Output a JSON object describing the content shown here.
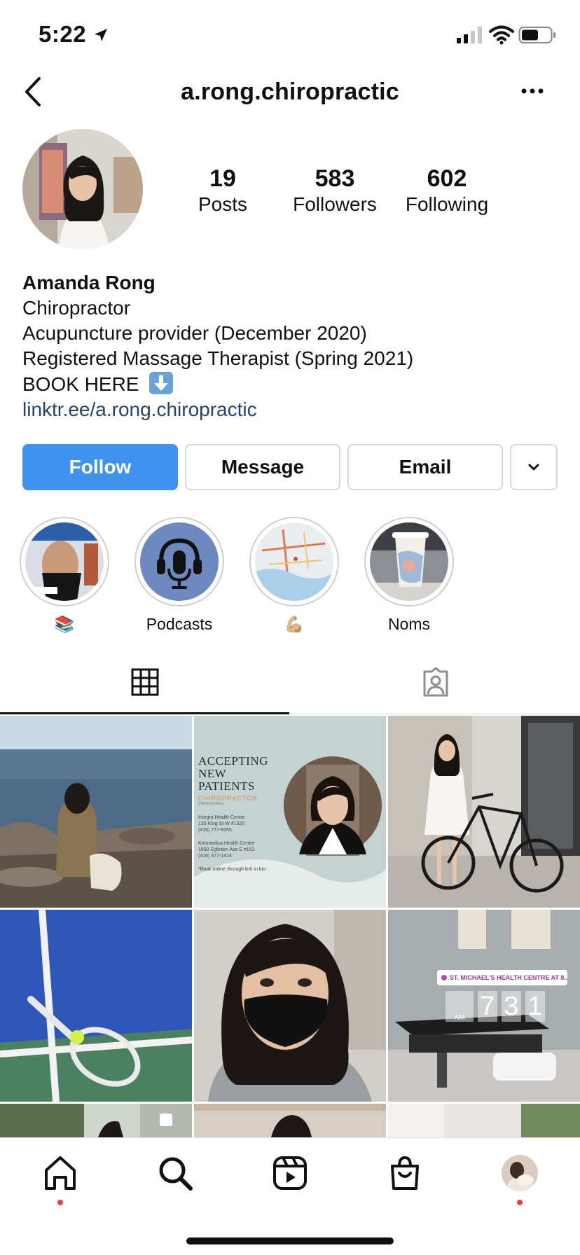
{
  "status": {
    "time": "5:22"
  },
  "header": {
    "title": "a.rong.chiropractic"
  },
  "profile": {
    "stats": [
      {
        "value": "19",
        "label": "Posts"
      },
      {
        "value": "583",
        "label": "Followers"
      },
      {
        "value": "602",
        "label": "Following"
      }
    ],
    "name": "Amanda Rong",
    "bio": [
      "Chiropractor",
      "Acupuncture provider (December 2020)",
      "Registered Massage Therapist (Spring 2021)"
    ],
    "book": "BOOK HERE",
    "link": "linktr.ee/a.rong.chiropractic"
  },
  "actions": {
    "follow": "Follow",
    "message": "Message",
    "email": "Email"
  },
  "highlights": [
    {
      "caption": "📚"
    },
    {
      "caption": "Podcasts"
    },
    {
      "caption": "💪🏼"
    },
    {
      "caption": "Noms"
    }
  ],
  "posts": {
    "p2": {
      "line1": "ACCEPTING",
      "line2": "NEW",
      "line3": "PATIENTS",
      "role": "CHIROPRACTOR",
      "sub": "(PROVISIONAL)",
      "loc1_name": "Integra Health Centre",
      "loc1_addr": "130 King St W #1320",
      "loc1_phone": "(416) 777-9355",
      "loc2_name": "Kiromedica Health Centre",
      "loc2_addr": "1880 Eglinton Ave E #153",
      "loc2_phone": "(416) 477-1414",
      "note": "*Book online through link in bio"
    },
    "p6": {
      "place": "ST. MICHAEL'S HEALTH CENTRE AT 8...",
      "d1": "7",
      "d2": "3",
      "d3": "1",
      "ampm": "AM"
    }
  },
  "colors": {
    "accent": "#3f93ee",
    "link": "#27436d",
    "notification": "#ee3c4a"
  }
}
